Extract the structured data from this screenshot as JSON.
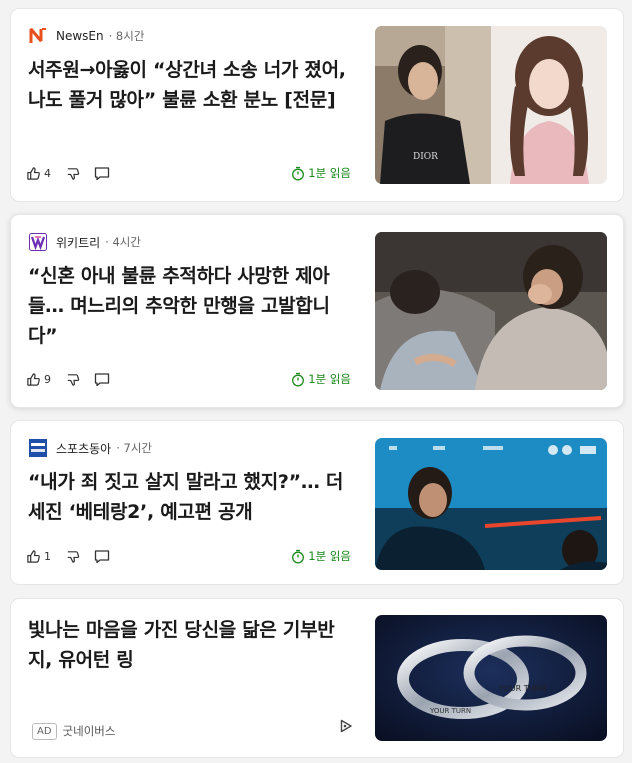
{
  "feed": [
    {
      "source": "NewsEn",
      "time": "· 8시간",
      "headline": "서주원→아옳이 “상간녀 소송 너가 졌어, 나도 풀거 많아” 불륜 소환 분노 [전문]",
      "likes": "4",
      "read_label": "1분 읽음",
      "logo_color": "#e8501e"
    },
    {
      "source": "위키트리",
      "time": "· 4시간",
      "headline": "“신혼 아내 불륜 추적하다 사망한 제아들… 며느리의 추악한 만행을 고발합니다”",
      "likes": "9",
      "read_label": "1분 읽음",
      "logo_color": "#6a2fb5"
    },
    {
      "source": "스포츠동아",
      "time": "· 7시간",
      "headline": "“내가 죄 짓고 살지 말라고 했지?”… 더 세진 ‘베테랑2’, 예고편 공개",
      "likes": "1",
      "read_label": "1분 읽음",
      "logo_color": "#1f4fa8",
      "logo_text": "스포츠동아"
    }
  ],
  "ad": {
    "headline": "빛나는 마음을 가진 당신을 닮은 기부반지, 유어턴 링",
    "badge": "AD",
    "advertiser": "굿네이버스",
    "ring_text": "YOUR TURN"
  },
  "colors": {
    "read_green": "#1a8a1a",
    "background": "#f3f3f3"
  }
}
